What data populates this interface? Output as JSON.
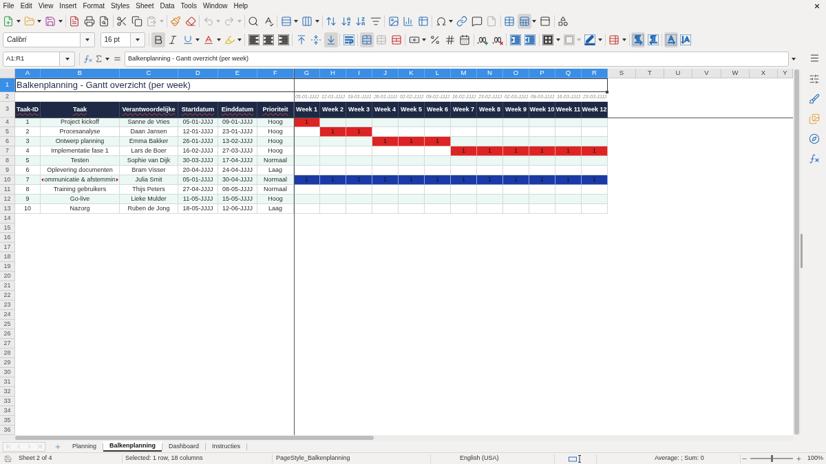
{
  "menu_bar": {
    "items": [
      "File",
      "Edit",
      "View",
      "Insert",
      "Format",
      "Styles",
      "Sheet",
      "Data",
      "Tools",
      "Window",
      "Help"
    ]
  },
  "standard_toolbar": {
    "paste": {
      "disabled": true
    },
    "undo": {
      "disabled": true
    },
    "redo": {
      "disabled": true
    },
    "headers_footers": {
      "disabled": true
    },
    "freeze_rows_columns": {
      "pressed": true
    }
  },
  "formatting_toolbar": {
    "font_name": "Calibri",
    "font_size": "16 pt",
    "bold": {
      "pressed": true
    },
    "italic": {
      "pressed": false
    },
    "underline": {
      "pressed": false
    },
    "align_left": {
      "pressed": false
    },
    "align_center": {
      "pressed": false
    },
    "align_right": {
      "pressed": false
    },
    "align_top": {
      "pressed": false
    },
    "center_vertically": {
      "pressed": false
    },
    "align_bottom": {
      "pressed": true
    },
    "wrap_text": {
      "pressed": false
    },
    "merge_and_center": {
      "pressed": true
    },
    "merge_cells": {
      "disabled": true
    },
    "border_style": {
      "disabled": true
    },
    "left_to_right": {
      "pressed": true
    },
    "right_to_left": {
      "pressed": false
    },
    "text_horizontal": {
      "pressed": true
    },
    "text_vertical": {
      "pressed": false
    }
  },
  "formula_bar": {
    "name_box": "A1:R1",
    "content": "Balkenplanning - Gantt overzicht (per week)"
  },
  "sheet": {
    "columns": [
      {
        "label": "A",
        "selected": true
      },
      {
        "label": "B",
        "selected": true
      },
      {
        "label": "C",
        "selected": true
      },
      {
        "label": "D",
        "selected": true
      },
      {
        "label": "E",
        "selected": true
      },
      {
        "label": "F",
        "selected": true
      },
      {
        "label": "G",
        "selected": true
      },
      {
        "label": "H",
        "selected": true
      },
      {
        "label": "I",
        "selected": true
      },
      {
        "label": "J",
        "selected": true
      },
      {
        "label": "K",
        "selected": true
      },
      {
        "label": "L",
        "selected": true
      },
      {
        "label": "M",
        "selected": true
      },
      {
        "label": "N",
        "selected": true
      },
      {
        "label": "O",
        "selected": true
      },
      {
        "label": "P",
        "selected": true
      },
      {
        "label": "Q",
        "selected": true
      },
      {
        "label": "R",
        "selected": true
      },
      {
        "label": "S",
        "selected": false
      },
      {
        "label": "T",
        "selected": false
      },
      {
        "label": "U",
        "selected": false
      },
      {
        "label": "V",
        "selected": false
      },
      {
        "label": "W",
        "selected": false
      },
      {
        "label": "X",
        "selected": false
      },
      {
        "label": "Y",
        "selected": false
      }
    ],
    "rows": [
      {
        "label": "1",
        "selected": true
      },
      {
        "label": "2",
        "selected": false
      },
      {
        "label": "3",
        "selected": false
      },
      {
        "label": "4",
        "selected": false
      },
      {
        "label": "5",
        "selected": false
      },
      {
        "label": "6",
        "selected": false
      },
      {
        "label": "7",
        "selected": false
      },
      {
        "label": "8",
        "selected": false
      },
      {
        "label": "9",
        "selected": false
      },
      {
        "label": "10",
        "selected": false
      },
      {
        "label": "11",
        "selected": false
      },
      {
        "label": "12",
        "selected": false
      },
      {
        "label": "13",
        "selected": false
      },
      {
        "label": "14",
        "selected": false
      },
      {
        "label": "15",
        "selected": false
      },
      {
        "label": "16",
        "selected": false
      },
      {
        "label": "17",
        "selected": false
      },
      {
        "label": "18",
        "selected": false
      },
      {
        "label": "19",
        "selected": false
      },
      {
        "label": "20",
        "selected": false
      },
      {
        "label": "21",
        "selected": false
      },
      {
        "label": "22",
        "selected": false
      },
      {
        "label": "23",
        "selected": false
      },
      {
        "label": "24",
        "selected": false
      },
      {
        "label": "25",
        "selected": false
      },
      {
        "label": "26",
        "selected": false
      },
      {
        "label": "27",
        "selected": false
      },
      {
        "label": "28",
        "selected": false
      },
      {
        "label": "29",
        "selected": false
      },
      {
        "label": "30",
        "selected": false
      },
      {
        "label": "31",
        "selected": false
      },
      {
        "label": "32",
        "selected": false
      },
      {
        "label": "33",
        "selected": false
      },
      {
        "label": "34",
        "selected": false
      },
      {
        "label": "35",
        "selected": false
      },
      {
        "label": "36",
        "selected": false
      }
    ],
    "title": "Balkenplanning - Gantt overzicht (per week)",
    "week_dates": [
      "05-01-JJJJ",
      "12-01-JJJJ",
      "19-01-JJJJ",
      "26-01-JJJJ",
      "02-02-JJJJ",
      "09-02-JJJJ",
      "16-02-JJJJ",
      "23-02-JJJJ",
      "02-03-JJJJ",
      "09-03-JJJJ",
      "16-03-JJJJ",
      "23-03-JJJJ"
    ],
    "headers": [
      "Taak-ID",
      "Taak",
      "Verantwoordelijke",
      "Startdatum",
      "Einddatum",
      "Prioriteit"
    ],
    "week_headers": [
      "Week 1",
      "Week 2",
      "Week 3",
      "Week 4",
      "Week 5",
      "Week 6",
      "Week 7",
      "Week 8",
      "Week 9",
      "Week 10",
      "Week 11",
      "Week 12"
    ],
    "tasks": [
      {
        "id": "1",
        "task": "Project kickoff",
        "owner": "Sanne de Vries",
        "start": "05-01-JJJJ",
        "end": "09-01-JJJJ",
        "priority": "Hoog",
        "clipped": false,
        "weeks": [
          {
            "filled": true,
            "value": "1",
            "color": "#dd2424"
          },
          {
            "filled": false
          },
          {
            "filled": false
          },
          {
            "filled": false
          },
          {
            "filled": false
          },
          {
            "filled": false
          },
          {
            "filled": false
          },
          {
            "filled": false
          },
          {
            "filled": false
          },
          {
            "filled": false
          },
          {
            "filled": false
          },
          {
            "filled": false
          }
        ]
      },
      {
        "id": "2",
        "task": "Procesanalyse",
        "owner": "Daan Jansen",
        "start": "12-01-JJJJ",
        "end": "23-01-JJJJ",
        "priority": "Hoog",
        "clipped": false,
        "weeks": [
          {
            "filled": false
          },
          {
            "filled": true,
            "value": "1",
            "color": "#dd2424"
          },
          {
            "filled": true,
            "value": "1",
            "color": "#dd2424"
          },
          {
            "filled": false
          },
          {
            "filled": false
          },
          {
            "filled": false
          },
          {
            "filled": false
          },
          {
            "filled": false
          },
          {
            "filled": false
          },
          {
            "filled": false
          },
          {
            "filled": false
          },
          {
            "filled": false
          }
        ]
      },
      {
        "id": "3",
        "task": "Ontwerp planning",
        "owner": "Emma Bakker",
        "start": "26-01-JJJJ",
        "end": "13-02-JJJJ",
        "priority": "Hoog",
        "clipped": false,
        "weeks": [
          {
            "filled": false
          },
          {
            "filled": false
          },
          {
            "filled": false
          },
          {
            "filled": true,
            "value": "1",
            "color": "#dd2424"
          },
          {
            "filled": true,
            "value": "1",
            "color": "#dd2424"
          },
          {
            "filled": true,
            "value": "1",
            "color": "#dd2424"
          },
          {
            "filled": false
          },
          {
            "filled": false
          },
          {
            "filled": false
          },
          {
            "filled": false
          },
          {
            "filled": false
          },
          {
            "filled": false
          }
        ]
      },
      {
        "id": "4",
        "task": "Implementatie fase 1",
        "owner": "Lars de Boer",
        "start": "16-02-JJJJ",
        "end": "27-03-JJJJ",
        "priority": "Hoog",
        "clipped": false,
        "weeks": [
          {
            "filled": false
          },
          {
            "filled": false
          },
          {
            "filled": false
          },
          {
            "filled": false
          },
          {
            "filled": false
          },
          {
            "filled": false
          },
          {
            "filled": true,
            "value": "1",
            "color": "#dd2424"
          },
          {
            "filled": true,
            "value": "1",
            "color": "#dd2424"
          },
          {
            "filled": true,
            "value": "1",
            "color": "#dd2424"
          },
          {
            "filled": true,
            "value": "1",
            "color": "#dd2424"
          },
          {
            "filled": true,
            "value": "1",
            "color": "#dd2424"
          },
          {
            "filled": true,
            "value": "1",
            "color": "#dd2424"
          }
        ]
      },
      {
        "id": "5",
        "task": "Testen",
        "owner": "Sophie van Dijk",
        "start": "30-03-JJJJ",
        "end": "17-04-JJJJ",
        "priority": "Normaal",
        "clipped": false,
        "weeks": [
          {
            "filled": false
          },
          {
            "filled": false
          },
          {
            "filled": false
          },
          {
            "filled": false
          },
          {
            "filled": false
          },
          {
            "filled": false
          },
          {
            "filled": false
          },
          {
            "filled": false
          },
          {
            "filled": false
          },
          {
            "filled": false
          },
          {
            "filled": false
          },
          {
            "filled": false
          }
        ]
      },
      {
        "id": "6",
        "task": "Oplevering documenten",
        "owner": "Bram Visser",
        "start": "20-04-JJJJ",
        "end": "24-04-JJJJ",
        "priority": "Laag",
        "clipped": false,
        "weeks": [
          {
            "filled": false
          },
          {
            "filled": false
          },
          {
            "filled": false
          },
          {
            "filled": false
          },
          {
            "filled": false
          },
          {
            "filled": false
          },
          {
            "filled": false
          },
          {
            "filled": false
          },
          {
            "filled": false
          },
          {
            "filled": false
          },
          {
            "filled": false
          },
          {
            "filled": false
          }
        ]
      },
      {
        "id": "7",
        "task": "ommunicatie & afstemmin",
        "owner": "Julia Smit",
        "start": "05-01-JJJJ",
        "end": "30-04-JJJJ",
        "priority": "Normaal",
        "clipped": true,
        "weeks": [
          {
            "filled": true,
            "value": "1",
            "color": "#1b3aa6"
          },
          {
            "filled": true,
            "value": "1",
            "color": "#1b3aa6"
          },
          {
            "filled": true,
            "value": "1",
            "color": "#1b3aa6"
          },
          {
            "filled": true,
            "value": "1",
            "color": "#1b3aa6"
          },
          {
            "filled": true,
            "value": "1",
            "color": "#1b3aa6"
          },
          {
            "filled": true,
            "value": "1",
            "color": "#1b3aa6"
          },
          {
            "filled": true,
            "value": "1",
            "color": "#1b3aa6"
          },
          {
            "filled": true,
            "value": "1",
            "color": "#1b3aa6"
          },
          {
            "filled": true,
            "value": "1",
            "color": "#1b3aa6"
          },
          {
            "filled": true,
            "value": "1",
            "color": "#1b3aa6"
          },
          {
            "filled": true,
            "value": "1",
            "color": "#1b3aa6"
          },
          {
            "filled": true,
            "value": "1",
            "color": "#1b3aa6"
          }
        ]
      },
      {
        "id": "8",
        "task": "Training gebruikers",
        "owner": "Thijs Peters",
        "start": "27-04-JJJJ",
        "end": "08-05-JJJJ",
        "priority": "Normaal",
        "clipped": false,
        "weeks": [
          {
            "filled": false
          },
          {
            "filled": false
          },
          {
            "filled": false
          },
          {
            "filled": false
          },
          {
            "filled": false
          },
          {
            "filled": false
          },
          {
            "filled": false
          },
          {
            "filled": false
          },
          {
            "filled": false
          },
          {
            "filled": false
          },
          {
            "filled": false
          },
          {
            "filled": false
          }
        ]
      },
      {
        "id": "9",
        "task": "Go-live",
        "owner": "Lieke Mulder",
        "start": "11-05-JJJJ",
        "end": "15-05-JJJJ",
        "priority": "Hoog",
        "clipped": false,
        "weeks": [
          {
            "filled": false
          },
          {
            "filled": false
          },
          {
            "filled": false
          },
          {
            "filled": false
          },
          {
            "filled": false
          },
          {
            "filled": false
          },
          {
            "filled": false
          },
          {
            "filled": false
          },
          {
            "filled": false
          },
          {
            "filled": false
          },
          {
            "filled": false
          },
          {
            "filled": false
          }
        ]
      },
      {
        "id": "10",
        "task": "Nazorg",
        "owner": "Ruben de Jong",
        "start": "18-05-JJJJ",
        "end": "12-06-JJJJ",
        "priority": "Laag",
        "clipped": false,
        "weeks": [
          {
            "filled": false
          },
          {
            "filled": false
          },
          {
            "filled": false
          },
          {
            "filled": false
          },
          {
            "filled": false
          },
          {
            "filled": false
          },
          {
            "filled": false
          },
          {
            "filled": false
          },
          {
            "filled": false
          },
          {
            "filled": false
          },
          {
            "filled": false
          },
          {
            "filled": false
          }
        ]
      }
    ]
  },
  "sheet_tabs": {
    "navigation": {
      "disabled": true
    },
    "tabs": [
      {
        "label": "Planning",
        "selected": false
      },
      {
        "label": "Balkenplanning",
        "selected": true
      },
      {
        "label": "Dashboard",
        "selected": false
      },
      {
        "label": "Instructies",
        "selected": false
      }
    ]
  },
  "status_bar": {
    "sheet": "Sheet 2 of 4",
    "selection": "Selected: 1 row, 18 columns",
    "page_style": "PageStyle_Balkenplanning",
    "language": "English (USA)",
    "summary": "Average: ; Sum: 0",
    "zoom": {
      "level": 0.5,
      "percent": "100%"
    }
  }
}
